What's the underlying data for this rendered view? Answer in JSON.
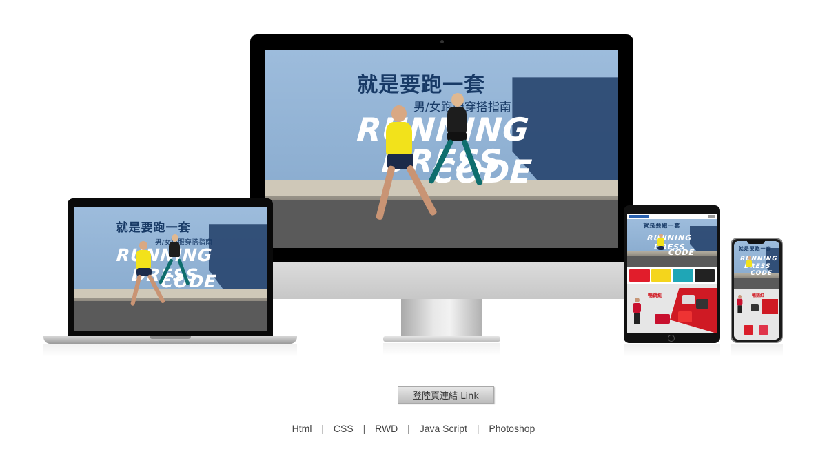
{
  "hero": {
    "zh_title": "就是要跑一套",
    "zh_subtitle": "男/女跑服穿搭指南",
    "en_line1": "RUNNING",
    "en_line2": "DRESS",
    "en_line3": "CODE"
  },
  "mobile": {
    "promo_label": "暢銷紅"
  },
  "link_button": {
    "label": "登陸頁連結  Link"
  },
  "skills": [
    "Html",
    "CSS",
    "RWD",
    "Java Script",
    "Photoshop"
  ],
  "skills_separator": "|",
  "colors": {
    "title_blue": "#183a66",
    "wall_blue": "#8fb0d3",
    "accent_red": "#cf1a24",
    "shirt_yellow": "#f2e21b"
  }
}
